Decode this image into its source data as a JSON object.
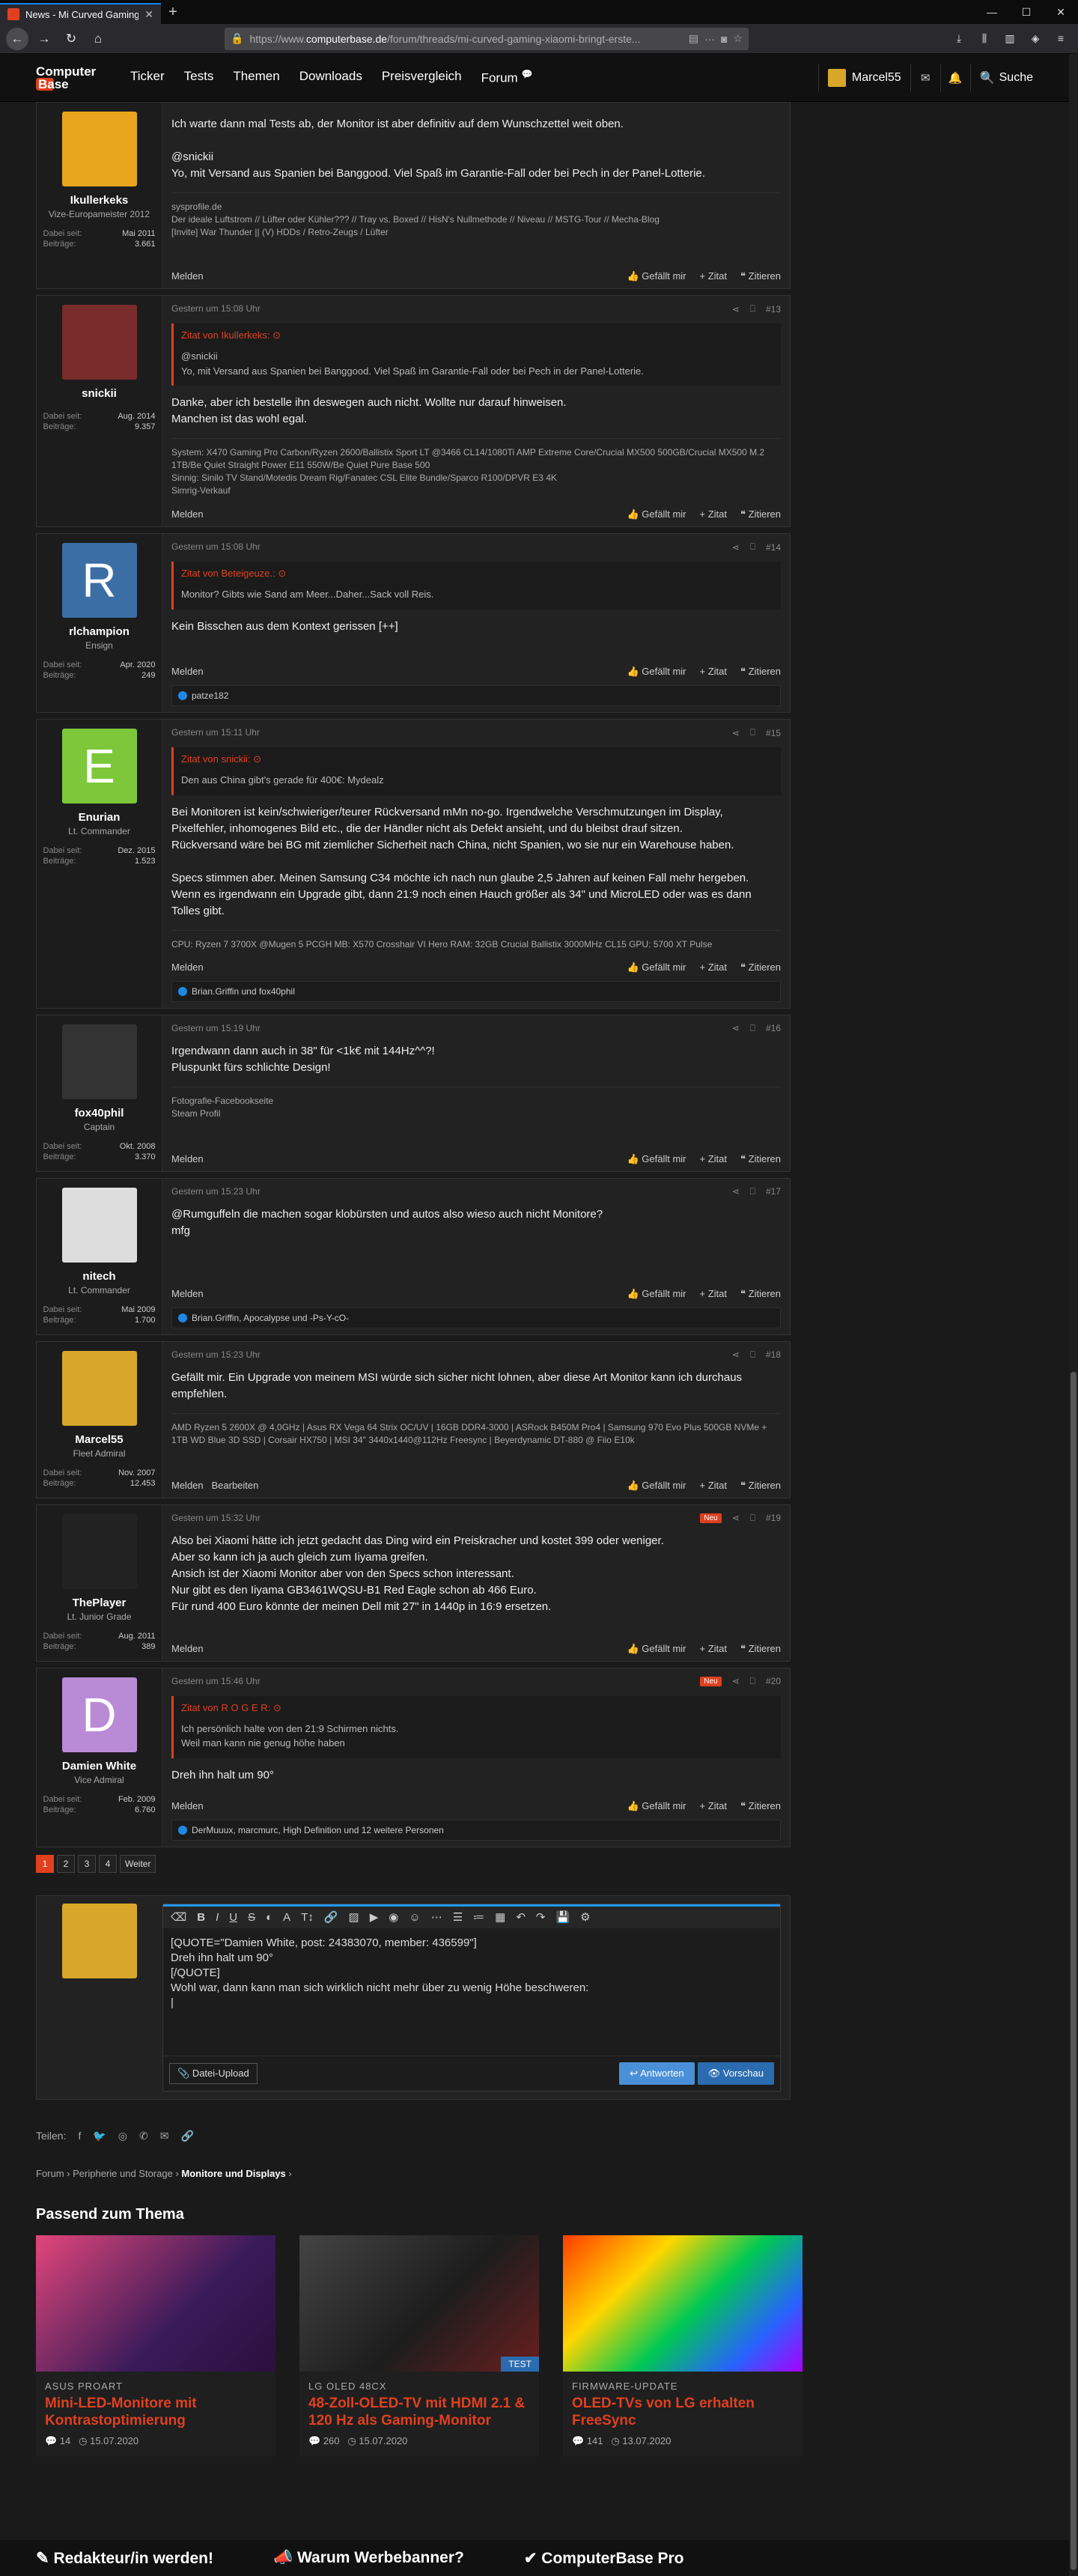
{
  "browser": {
    "tab_title": "News - Mi Curved Gaming: Xiaomi",
    "url_prefix": "https://www.",
    "url_host": "computerbase.de",
    "url_path": "/forum/threads/mi-curved-gaming-xiaomi-bringt-erste..."
  },
  "header": {
    "logo_line1": "Computer",
    "logo_line2": "Base",
    "nav": [
      "Ticker",
      "Tests",
      "Themen",
      "Downloads",
      "Preisvergleich",
      "Forum"
    ],
    "user": "Marcel55",
    "search": "Suche"
  },
  "labels": {
    "member_since": "Dabei seit:",
    "posts": "Beiträge:",
    "report": "Melden",
    "edit": "Bearbeiten",
    "like": "Gefällt mir",
    "quote": "Zitat",
    "reply_quote": "Zitieren",
    "new": "Neu"
  },
  "posts": [
    {
      "user": "Ikullerkeks",
      "title": "Vize-Europameister 2012",
      "since": "Mai 2011",
      "count": "3.661",
      "date": "",
      "num": "",
      "quote_author": "",
      "quote_text": "",
      "lines": [
        "Ich warte dann mal Tests ab, der Monitor ist aber definitiv auf dem Wunschzettel weit oben.",
        "",
        "@snickii",
        "Yo, mit Versand aus Spanien bei Banggood. Viel Spaß im Garantie-Fall oder bei Pech in der Panel-Lotterie."
      ],
      "sig": [
        "sysprofile.de",
        "Der ideale Luftstrom // Lüfter oder Kühler??? // Tray vs. Boxed // HisN's Nullmethode // Niveau // MSTG-Tour // Mecha-Blog",
        "[Invite] War Thunder || (V) HDDs / Retro-Zeugs / Lüfter"
      ],
      "reactions": ""
    },
    {
      "user": "snickii",
      "title": "",
      "since": "Aug. 2014",
      "count": "9.357",
      "date": "Gestern um 15:08 Uhr",
      "num": "#13",
      "quote_author": "Zitat von Ikullerkeks:",
      "quote_text": "@snickii\nYo, mit Versand aus Spanien bei Banggood. Viel Spaß im Garantie-Fall oder bei Pech in der Panel-Lotterie.",
      "lines": [
        "Danke, aber ich bestelle ihn deswegen auch nicht. Wollte nur darauf hinweisen.",
        "Manchen ist das wohl egal."
      ],
      "sig": [
        "System: X470 Gaming Pro Carbon/Ryzen 2600/Ballistix Sport LT @3466 CL14/1080Ti AMP Extreme Core/Crucial MX500 500GB/Crucial MX500 M.2 1TB/Be Quiet Straight Power E11 550W/Be Quiet Pure Base 500",
        "Sinnig: Sinilo TV Stand/Motedis Dream Rig/Fanatec CSL Elite Bundle/Sparco R100/DPVR E3 4K",
        "Simrig-Verkauf"
      ],
      "reactions": ""
    },
    {
      "user": "rlchampion",
      "title": "Ensign",
      "since": "Apr. 2020",
      "count": "249",
      "date": "Gestern um 15:08 Uhr",
      "num": "#14",
      "quote_author": "Zitat von Beteigeuze.:",
      "quote_text": "Monitor? Gibts wie Sand am Meer...Daher...Sack voll Reis.",
      "lines": [
        "Kein Bisschen aus dem Kontext gerissen [++]"
      ],
      "sig": [],
      "reactions": "patze182"
    },
    {
      "user": "Enurian",
      "title": "Lt. Commander",
      "since": "Dez. 2015",
      "count": "1.523",
      "date": "Gestern um 15:11 Uhr",
      "num": "#15",
      "quote_author": "Zitat von snickii:",
      "quote_text": "Den aus China gibt's gerade für 400€: Mydealz",
      "lines": [
        "Bei Monitoren ist kein/schwieriger/teurer Rückversand mMn no-go. Irgendwelche Verschmutzungen im Display, Pixelfehler, inhomogenes Bild etc., die der Händler nicht als Defekt ansieht, und du bleibst drauf sitzen.",
        "Rückversand wäre bei BG mit ziemlicher Sicherheit nach China, nicht Spanien, wo sie nur ein Warehouse haben.",
        "",
        "Specs stimmen aber. Meinen Samsung C34 möchte ich nach nun glaube 2,5 Jahren auf keinen Fall mehr hergeben.",
        "Wenn es irgendwann ein Upgrade gibt, dann 21:9 noch einen Hauch größer als 34\" und MicroLED oder was es dann Tolles gibt."
      ],
      "sig": [
        "CPU: Ryzen 7 3700X @Mugen 5 PCGH MB: X570 Crosshair VI Hero RAM: 32GB Crucial Ballistix 3000MHz CL15 GPU: 5700 XT Pulse"
      ],
      "reactions": "Brian.Griffin und fox40phil"
    },
    {
      "user": "fox40phil",
      "title": "Captain",
      "since": "Okt. 2008",
      "count": "3.370",
      "date": "Gestern um 15:19 Uhr",
      "num": "#16",
      "quote_author": "",
      "quote_text": "",
      "lines": [
        "Irgendwann dann auch in 38\" für <1k€ mit 144Hz^^?!",
        "Pluspunkt fürs schlichte Design!"
      ],
      "sig": [
        "Fotografie-Facebookseite",
        "Steam Profil"
      ],
      "reactions": ""
    },
    {
      "user": "nitech",
      "title": "Lt. Commander",
      "since": "Mai 2009",
      "count": "1.700",
      "date": "Gestern um 15:23 Uhr",
      "num": "#17",
      "quote_author": "",
      "quote_text": "",
      "lines": [
        "@Rumguffeln die machen sogar klobürsten und autos also wieso auch nicht Monitore?",
        "mfg"
      ],
      "sig": [],
      "reactions": "Brian.Griffin, Apocalypse und -Ps-Y-cO-"
    },
    {
      "user": "Marcel55",
      "title": "Fleet Admiral",
      "since": "Nov. 2007",
      "count": "12.453",
      "date": "Gestern um 15:23 Uhr",
      "num": "#18",
      "quote_author": "",
      "quote_text": "",
      "lines": [
        "Gefällt mir. Ein Upgrade von meinem MSI würde sich sicher nicht lohnen, aber diese Art Monitor kann ich durchaus empfehlen."
      ],
      "sig": [
        "AMD Ryzen 5 2600X @ 4,0GHz | Asus RX Vega 64 Strix OC/UV | 16GB DDR4-3000 | ASRock B450M Pro4 | Samsung 970 Evo Plus 500GB NVMe + 1TB WD Blue 3D SSD | Corsair HX750 | MSI 34\" 3440x1440@112Hz Freesync | Beyerdynamic DT-880 @ Fiio E10k"
      ],
      "reactions": ""
    },
    {
      "user": "ThePlayer",
      "title": "Lt. Junior Grade",
      "since": "Aug. 2011",
      "count": "389",
      "date": "Gestern um 15:32 Uhr",
      "num": "#19",
      "quote_author": "",
      "quote_text": "",
      "lines": [
        "Also bei Xiaomi hätte ich jetzt gedacht das Ding wird ein Preiskracher und kostet 399 oder weniger.",
        "Aber so kann ich ja auch gleich zum Iiyama greifen.",
        "Ansich ist der Xiaomi Monitor aber von den Specs schon interessant.",
        "Nur gibt es den Iiyama GB3461WQSU-B1 Red Eagle schon ab 466 Euro.",
        "Für rund 400 Euro könnte der meinen Dell mit 27\" in 1440p in 16:9 ersetzen."
      ],
      "sig": [],
      "reactions": ""
    },
    {
      "user": "Damien White",
      "title": "Vice Admiral",
      "since": "Feb. 2009",
      "count": "6.760",
      "date": "Gestern um 15:46 Uhr",
      "num": "#20",
      "quote_author": "Zitat von R O G E R:",
      "quote_text": "Ich persönlich halte von den 21:9 Schirmen nichts.\nWeil man kann nie genug höhe haben",
      "lines": [
        "Dreh ihn halt um 90°"
      ],
      "sig": [],
      "reactions": "DerMuuux, marcmurc, High Definition und 12 weitere Personen"
    }
  ],
  "pager": [
    "1",
    "2",
    "3",
    "4",
    "Weiter"
  ],
  "editor": {
    "text": "[QUOTE=\"Damien White, post: 24383070, member: 436599\"]\nDreh ihn halt um 90°\n[/QUOTE]\nWohl war, dann kann man sich wirklich nicht mehr über zu wenig Höhe beschweren:\n|",
    "upload": "Datei-Upload",
    "reply": "Antworten",
    "preview": "Vorschau"
  },
  "share_label": "Teilen:",
  "breadcrumb": [
    "Forum",
    "Peripherie und Storage",
    "Monitore und Displays"
  ],
  "related": {
    "heading": "Passend zum Thema",
    "cards": [
      {
        "kicker": "ASUS PROART",
        "title": "Mini-LED-Monitore mit Kontrastoptimierung",
        "comments": "14",
        "date": "15.07.2020",
        "tag": ""
      },
      {
        "kicker": "LG OLED 48CX",
        "title": "48-Zoll-OLED-TV mit HDMI 2.1 & 120 Hz als Gaming-Monitor",
        "comments": "260",
        "date": "15.07.2020",
        "tag": "TEST"
      },
      {
        "kicker": "FIRMWARE-UPDATE",
        "title": "OLED-TVs von LG erhalten FreeSync",
        "comments": "141",
        "date": "13.07.2020",
        "tag": ""
      }
    ]
  },
  "footer": [
    "Redakteur/in werden!",
    "Warum Werbebanner?",
    "ComputerBase Pro"
  ],
  "colors": {
    "accent": "#e0401f",
    "avatar_rl": "#3a6ea5",
    "avatar_en": "#7cc83a",
    "avatar_dw": "#b98ad6"
  }
}
